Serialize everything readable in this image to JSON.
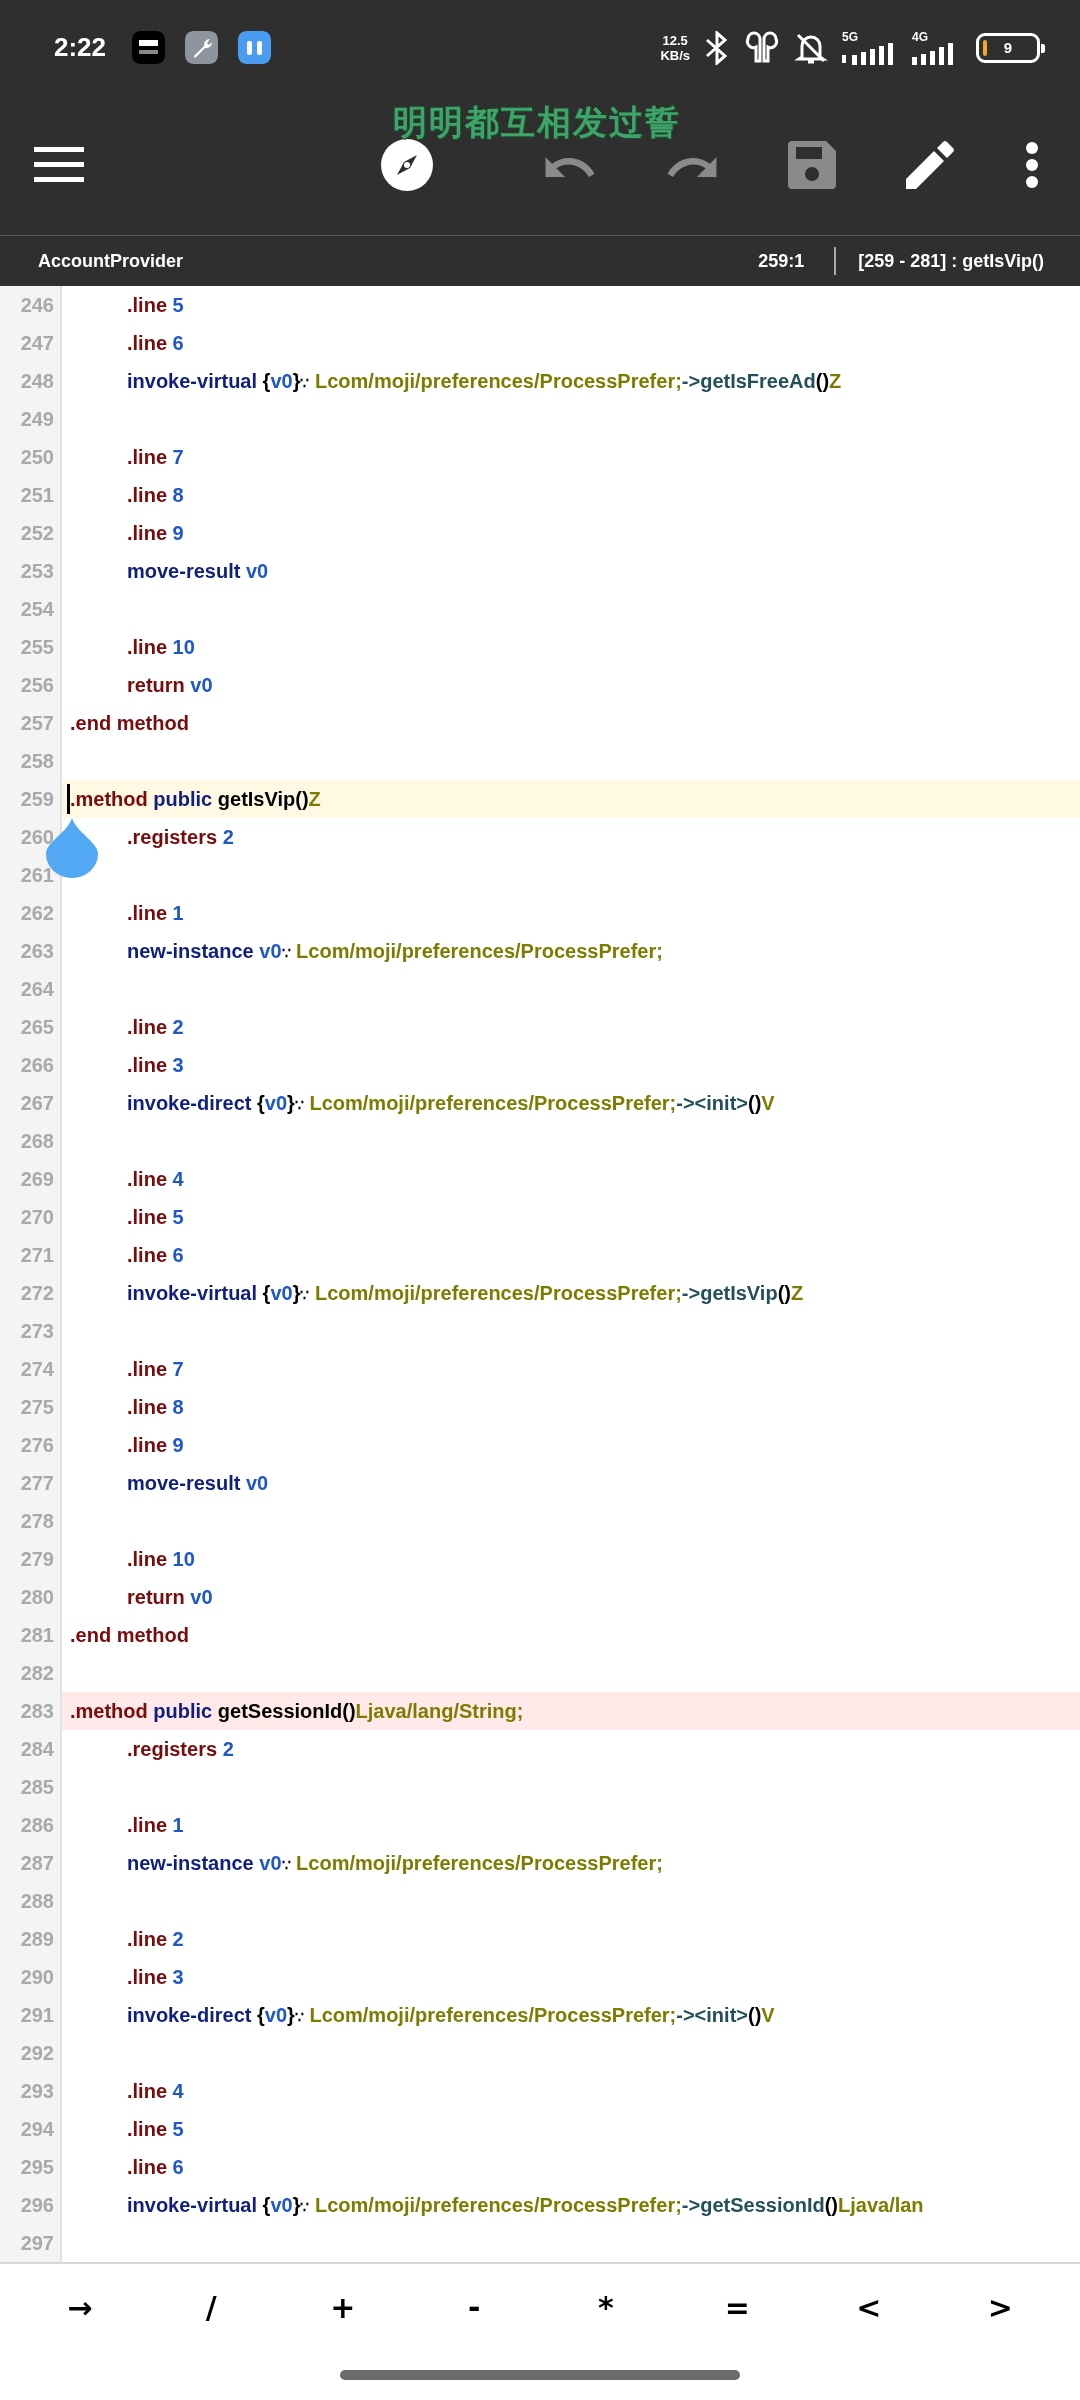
{
  "status_bar": {
    "time": "2:22",
    "net_speed": "12.5",
    "net_unit": "KB/s",
    "net_5g": "5G",
    "net_4g": "4G",
    "battery": "9"
  },
  "toolbar": {
    "buttons": [
      {
        "kind": "menu",
        "disabled": false
      },
      {
        "kind": "navigate",
        "disabled": false
      },
      {
        "kind": "undo",
        "disabled": true
      },
      {
        "kind": "redo",
        "disabled": true
      },
      {
        "kind": "save",
        "disabled": true
      },
      {
        "kind": "edit",
        "disabled": false
      },
      {
        "kind": "more",
        "disabled": false
      }
    ]
  },
  "lyric_overlay": "明明都互相发过誓",
  "info_bar": {
    "file": "AccountProvider",
    "position": "259:1",
    "range": "[259 - 281] : getIsVip()"
  },
  "lines": [
    {
      "number": "246",
      "current": false,
      "error": false,
      "indented": true,
      "words": [
        [
          {
            "kind": "directive",
            "text": ".line"
          }
        ],
        [
          {
            "kind": "number",
            "text": "5"
          }
        ]
      ]
    },
    {
      "number": "247",
      "current": false,
      "error": false,
      "indented": true,
      "words": [
        [
          {
            "kind": "directive",
            "text": ".line"
          }
        ],
        [
          {
            "kind": "number",
            "text": "6"
          }
        ]
      ]
    },
    {
      "number": "248",
      "current": false,
      "error": false,
      "indented": true,
      "words": [
        [
          {
            "kind": "op",
            "text": "invoke-virtual"
          }
        ],
        [
          {
            "kind": "plain",
            "text": "{"
          },
          {
            "kind": "number",
            "text": "v0"
          },
          {
            "kind": "plain",
            "text": "}"
          },
          {
            "kind": "space-mark",
            "text": "∵"
          }
        ],
        [
          {
            "kind": "type",
            "text": "Lcom/moji/preferences/ProcessPrefer;"
          },
          {
            "kind": "member",
            "text": "->getIsFreeAd"
          },
          {
            "kind": "plain",
            "text": "()"
          },
          {
            "kind": "type",
            "text": "Z"
          }
        ]
      ]
    },
    {
      "number": "249",
      "current": false,
      "error": false
    },
    {
      "number": "250",
      "current": false,
      "error": false,
      "indented": true,
      "words": [
        [
          {
            "kind": "directive",
            "text": ".line"
          }
        ],
        [
          {
            "kind": "number",
            "text": "7"
          }
        ]
      ]
    },
    {
      "number": "251",
      "current": false,
      "error": false,
      "indented": true,
      "words": [
        [
          {
            "kind": "directive",
            "text": ".line"
          }
        ],
        [
          {
            "kind": "number",
            "text": "8"
          }
        ]
      ]
    },
    {
      "number": "252",
      "current": false,
      "error": false,
      "indented": true,
      "words": [
        [
          {
            "kind": "directive",
            "text": ".line"
          }
        ],
        [
          {
            "kind": "number",
            "text": "9"
          }
        ]
      ]
    },
    {
      "number": "253",
      "current": false,
      "error": false,
      "indented": true,
      "words": [
        [
          {
            "kind": "op",
            "text": "move-result"
          }
        ],
        [
          {
            "kind": "number",
            "text": "v0"
          }
        ]
      ]
    },
    {
      "number": "254",
      "current": false,
      "error": false
    },
    {
      "number": "255",
      "current": false,
      "error": false,
      "indented": true,
      "words": [
        [
          {
            "kind": "directive",
            "text": ".line"
          }
        ],
        [
          {
            "kind": "number",
            "text": "10"
          }
        ]
      ]
    },
    {
      "number": "256",
      "current": false,
      "error": false,
      "indented": true,
      "words": [
        [
          {
            "kind": "directive",
            "text": "return"
          }
        ],
        [
          {
            "kind": "number",
            "text": "v0"
          }
        ]
      ]
    },
    {
      "number": "257",
      "current": false,
      "error": false,
      "indented": false,
      "words": [
        [
          {
            "kind": "directive",
            "text": ".end"
          }
        ],
        [
          {
            "kind": "directive",
            "text": "method"
          }
        ]
      ]
    },
    {
      "number": "258",
      "current": false,
      "error": false
    },
    {
      "number": "259",
      "current": true,
      "error": false,
      "indented": false,
      "words": [
        [
          {
            "kind": "directive",
            "text": ".method"
          }
        ],
        [
          {
            "kind": "op",
            "text": "public"
          }
        ],
        [
          {
            "kind": "plain",
            "text": "getIsVip()"
          },
          {
            "kind": "type",
            "text": "Z"
          }
        ]
      ]
    },
    {
      "number": "260",
      "current": false,
      "error": false,
      "indented": true,
      "words": [
        [
          {
            "kind": "directive",
            "text": ".registers"
          }
        ],
        [
          {
            "kind": "number",
            "text": "2"
          }
        ]
      ]
    },
    {
      "number": "261",
      "current": false,
      "error": false
    },
    {
      "number": "262",
      "current": false,
      "error": false,
      "indented": true,
      "words": [
        [
          {
            "kind": "directive",
            "text": ".line"
          }
        ],
        [
          {
            "kind": "number",
            "text": "1"
          }
        ]
      ]
    },
    {
      "number": "263",
      "current": false,
      "error": false,
      "indented": true,
      "words": [
        [
          {
            "kind": "op",
            "text": "new-instance"
          }
        ],
        [
          {
            "kind": "number",
            "text": "v0"
          },
          {
            "kind": "space-mark",
            "text": "∵"
          }
        ],
        [
          {
            "kind": "type",
            "text": "Lcom/moji/preferences/ProcessPrefer;"
          }
        ]
      ]
    },
    {
      "number": "264",
      "current": false,
      "error": false
    },
    {
      "number": "265",
      "current": false,
      "error": false,
      "indented": true,
      "words": [
        [
          {
            "kind": "directive",
            "text": ".line"
          }
        ],
        [
          {
            "kind": "number",
            "text": "2"
          }
        ]
      ]
    },
    {
      "number": "266",
      "current": false,
      "error": false,
      "indented": true,
      "words": [
        [
          {
            "kind": "directive",
            "text": ".line"
          }
        ],
        [
          {
            "kind": "number",
            "text": "3"
          }
        ]
      ]
    },
    {
      "number": "267",
      "current": false,
      "error": false,
      "indented": true,
      "words": [
        [
          {
            "kind": "op",
            "text": "invoke-direct"
          }
        ],
        [
          {
            "kind": "plain",
            "text": "{"
          },
          {
            "kind": "number",
            "text": "v0"
          },
          {
            "kind": "plain",
            "text": "}"
          },
          {
            "kind": "space-mark",
            "text": "∵"
          }
        ],
        [
          {
            "kind": "type",
            "text": "Lcom/moji/preferences/ProcessPrefer;"
          },
          {
            "kind": "member",
            "text": "-><init>"
          },
          {
            "kind": "plain",
            "text": "()"
          },
          {
            "kind": "type",
            "text": "V"
          }
        ]
      ]
    },
    {
      "number": "268",
      "current": false,
      "error": false
    },
    {
      "number": "269",
      "current": false,
      "error": false,
      "indented": true,
      "words": [
        [
          {
            "kind": "directive",
            "text": ".line"
          }
        ],
        [
          {
            "kind": "number",
            "text": "4"
          }
        ]
      ]
    },
    {
      "number": "270",
      "current": false,
      "error": false,
      "indented": true,
      "words": [
        [
          {
            "kind": "directive",
            "text": ".line"
          }
        ],
        [
          {
            "kind": "number",
            "text": "5"
          }
        ]
      ]
    },
    {
      "number": "271",
      "current": false,
      "error": false,
      "indented": true,
      "words": [
        [
          {
            "kind": "directive",
            "text": ".line"
          }
        ],
        [
          {
            "kind": "number",
            "text": "6"
          }
        ]
      ]
    },
    {
      "number": "272",
      "current": false,
      "error": false,
      "indented": true,
      "words": [
        [
          {
            "kind": "op",
            "text": "invoke-virtual"
          }
        ],
        [
          {
            "kind": "plain",
            "text": "{"
          },
          {
            "kind": "number",
            "text": "v0"
          },
          {
            "kind": "plain",
            "text": "}"
          },
          {
            "kind": "space-mark",
            "text": "∵"
          }
        ],
        [
          {
            "kind": "type",
            "text": "Lcom/moji/preferences/ProcessPrefer;"
          },
          {
            "kind": "member",
            "text": "->getIsVip"
          },
          {
            "kind": "plain",
            "text": "()"
          },
          {
            "kind": "type",
            "text": "Z"
          }
        ]
      ]
    },
    {
      "number": "273",
      "current": false,
      "error": false
    },
    {
      "number": "274",
      "current": false,
      "error": false,
      "indented": true,
      "words": [
        [
          {
            "kind": "directive",
            "text": ".line"
          }
        ],
        [
          {
            "kind": "number",
            "text": "7"
          }
        ]
      ]
    },
    {
      "number": "275",
      "current": false,
      "error": false,
      "indented": true,
      "words": [
        [
          {
            "kind": "directive",
            "text": ".line"
          }
        ],
        [
          {
            "kind": "number",
            "text": "8"
          }
        ]
      ]
    },
    {
      "number": "276",
      "current": false,
      "error": false,
      "indented": true,
      "words": [
        [
          {
            "kind": "directive",
            "text": ".line"
          }
        ],
        [
          {
            "kind": "number",
            "text": "9"
          }
        ]
      ]
    },
    {
      "number": "277",
      "current": false,
      "error": false,
      "indented": true,
      "words": [
        [
          {
            "kind": "op",
            "text": "move-result"
          }
        ],
        [
          {
            "kind": "number",
            "text": "v0"
          }
        ]
      ]
    },
    {
      "number": "278",
      "current": false,
      "error": false
    },
    {
      "number": "279",
      "current": false,
      "error": false,
      "indented": true,
      "words": [
        [
          {
            "kind": "directive",
            "text": ".line"
          }
        ],
        [
          {
            "kind": "number",
            "text": "10"
          }
        ]
      ]
    },
    {
      "number": "280",
      "current": false,
      "error": false,
      "indented": true,
      "words": [
        [
          {
            "kind": "directive",
            "text": "return"
          }
        ],
        [
          {
            "kind": "number",
            "text": "v0"
          }
        ]
      ]
    },
    {
      "number": "281",
      "current": false,
      "error": false,
      "indented": false,
      "words": [
        [
          {
            "kind": "directive",
            "text": ".end"
          }
        ],
        [
          {
            "kind": "directive",
            "text": "method"
          }
        ]
      ]
    },
    {
      "number": "282",
      "current": false,
      "error": false
    },
    {
      "number": "283",
      "current": false,
      "error": true,
      "indented": false,
      "words": [
        [
          {
            "kind": "directive",
            "text": ".method"
          }
        ],
        [
          {
            "kind": "op",
            "text": "public"
          }
        ],
        [
          {
            "kind": "plain",
            "text": "getSessionId()"
          },
          {
            "kind": "type",
            "text": "Ljava/lang/String;"
          }
        ]
      ]
    },
    {
      "number": "284",
      "current": false,
      "error": false,
      "indented": true,
      "words": [
        [
          {
            "kind": "directive",
            "text": ".registers"
          }
        ],
        [
          {
            "kind": "number",
            "text": "2"
          }
        ]
      ]
    },
    {
      "number": "285",
      "current": false,
      "error": false
    },
    {
      "number": "286",
      "current": false,
      "error": false,
      "indented": true,
      "words": [
        [
          {
            "kind": "directive",
            "text": ".line"
          }
        ],
        [
          {
            "kind": "number",
            "text": "1"
          }
        ]
      ]
    },
    {
      "number": "287",
      "current": false,
      "error": false,
      "indented": true,
      "words": [
        [
          {
            "kind": "op",
            "text": "new-instance"
          }
        ],
        [
          {
            "kind": "number",
            "text": "v0"
          },
          {
            "kind": "space-mark",
            "text": "∵"
          }
        ],
        [
          {
            "kind": "type",
            "text": "Lcom/moji/preferences/ProcessPrefer;"
          }
        ]
      ]
    },
    {
      "number": "288",
      "current": false,
      "error": false
    },
    {
      "number": "289",
      "current": false,
      "error": false,
      "indented": true,
      "words": [
        [
          {
            "kind": "directive",
            "text": ".line"
          }
        ],
        [
          {
            "kind": "number",
            "text": "2"
          }
        ]
      ]
    },
    {
      "number": "290",
      "current": false,
      "error": false,
      "indented": true,
      "words": [
        [
          {
            "kind": "directive",
            "text": ".line"
          }
        ],
        [
          {
            "kind": "number",
            "text": "3"
          }
        ]
      ]
    },
    {
      "number": "291",
      "current": false,
      "error": false,
      "indented": true,
      "words": [
        [
          {
            "kind": "op",
            "text": "invoke-direct"
          }
        ],
        [
          {
            "kind": "plain",
            "text": "{"
          },
          {
            "kind": "number",
            "text": "v0"
          },
          {
            "kind": "plain",
            "text": "}"
          },
          {
            "kind": "space-mark",
            "text": "∵"
          }
        ],
        [
          {
            "kind": "type",
            "text": "Lcom/moji/preferences/ProcessPrefer;"
          },
          {
            "kind": "member",
            "text": "-><init>"
          },
          {
            "kind": "plain",
            "text": "()"
          },
          {
            "kind": "type",
            "text": "V"
          }
        ]
      ]
    },
    {
      "number": "292",
      "current": false,
      "error": false
    },
    {
      "number": "293",
      "current": false,
      "error": false,
      "indented": true,
      "words": [
        [
          {
            "kind": "directive",
            "text": ".line"
          }
        ],
        [
          {
            "kind": "number",
            "text": "4"
          }
        ]
      ]
    },
    {
      "number": "294",
      "current": false,
      "error": false,
      "indented": true,
      "words": [
        [
          {
            "kind": "directive",
            "text": ".line"
          }
        ],
        [
          {
            "kind": "number",
            "text": "5"
          }
        ]
      ]
    },
    {
      "number": "295",
      "current": false,
      "error": false,
      "indented": true,
      "words": [
        [
          {
            "kind": "directive",
            "text": ".line"
          }
        ],
        [
          {
            "kind": "number",
            "text": "6"
          }
        ]
      ]
    },
    {
      "number": "296",
      "current": false,
      "error": false,
      "indented": true,
      "words": [
        [
          {
            "kind": "op",
            "text": "invoke-virtual"
          }
        ],
        [
          {
            "kind": "plain",
            "text": "{"
          },
          {
            "kind": "number",
            "text": "v0"
          },
          {
            "kind": "plain",
            "text": "}"
          },
          {
            "kind": "space-mark",
            "text": "∵"
          }
        ],
        [
          {
            "kind": "type",
            "text": "Lcom/moji/preferences/ProcessPrefer;"
          },
          {
            "kind": "member",
            "text": "->getSessionId"
          },
          {
            "kind": "plain",
            "text": "()"
          },
          {
            "kind": "type",
            "text": "Ljava/lan"
          }
        ]
      ]
    },
    {
      "number": "297",
      "current": false,
      "error": false
    }
  ],
  "symbol_keys": [
    "→",
    "/",
    "+",
    "-",
    "*",
    "=",
    "<",
    ">"
  ]
}
